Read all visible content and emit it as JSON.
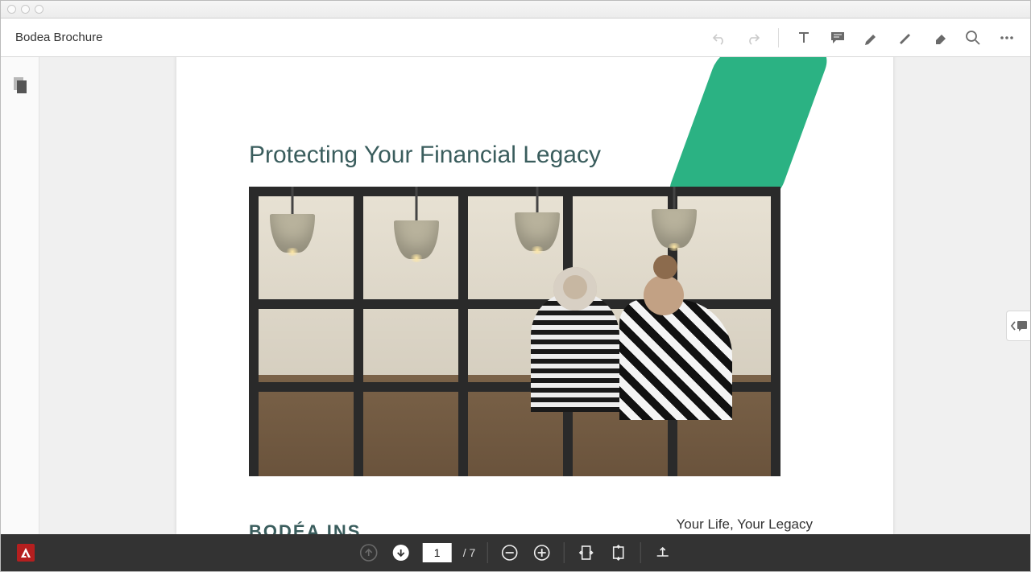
{
  "app": {
    "document_title": "Bodea Brochure"
  },
  "toolbar": {
    "undo": "undo",
    "redo": "redo",
    "text": "text",
    "comment": "comment",
    "highlight": "highlight",
    "draw": "draw",
    "erase": "erase",
    "search": "search",
    "more": "more"
  },
  "document": {
    "heading": "Protecting Your Financial Legacy",
    "tagline": "Your Life, Your Legacy",
    "logo_text": "BODÉA INS",
    "accent_color": "#2bb283"
  },
  "pager": {
    "current": "1",
    "total": "/ 7"
  }
}
